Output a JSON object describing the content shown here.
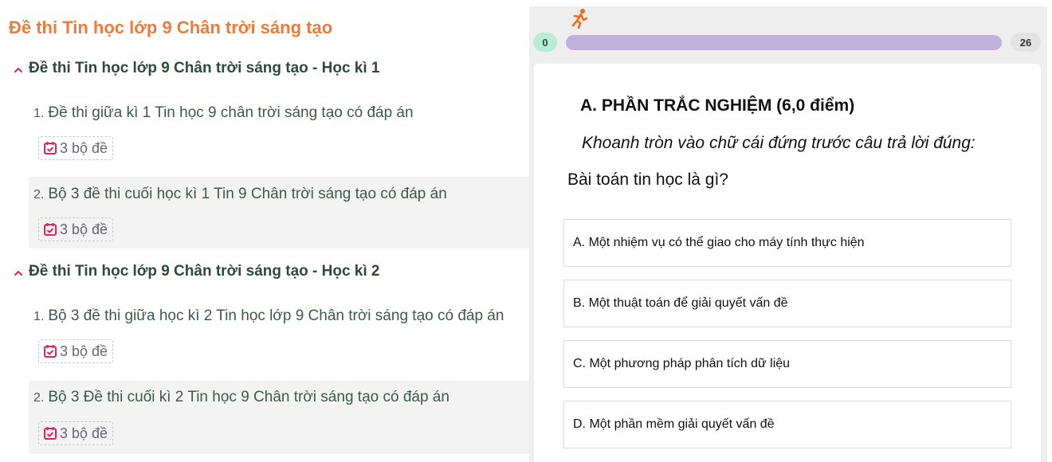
{
  "page_title": "Đề thi Tin học lớp 9 Chân trời sáng tạo",
  "sections": [
    {
      "heading": "Đề thi Tin học lớp 9 Chân trời sáng tạo - Học kì 1",
      "items": [
        {
          "number": "1.",
          "title": "Đề thi giữa kì 1 Tin học 9 chân trời sáng tạo có đáp án",
          "badge": "3 bộ đề"
        },
        {
          "number": "2.",
          "title": "Bộ 3 đề thi cuối học kì 1 Tin 9 Chân trời sáng tạo có đáp án",
          "badge": "3 bộ đề"
        }
      ]
    },
    {
      "heading": "Đề thi Tin học lớp 9 Chân trời sáng tạo - Học kì 2",
      "items": [
        {
          "number": "1.",
          "title": "Bộ 3 đề thi giữa học kì 2 Tin học lớp 9 Chân trời sáng tạo có đáp án",
          "badge": "3 bộ đề"
        },
        {
          "number": "2.",
          "title": "Bộ 3 Đề thi cuối kì 2 Tin học 9 Chân trời sáng tạo có đáp án",
          "badge": "3 bộ đề"
        }
      ]
    }
  ],
  "quiz": {
    "progress": {
      "current": "0",
      "total": "26",
      "fill_fraction": 1.0
    },
    "runner_icon": "running-person-icon",
    "section_title": "A. PHẦN TRẮC NGHIỆM (6,0 điểm)",
    "instruction": "Khoanh tròn vào chữ cái đứng trước câu trả lời đúng:",
    "question": "Bài toán tin học là gì?",
    "options": [
      "A. Một nhiệm vụ có thể giao cho máy tính thực hiện",
      "B. Một thuật toán để giải quyết vấn đề",
      "C. Một phương pháp phân tích dữ liệu",
      "D. Một phần mềm giải quyết vấn đề"
    ]
  },
  "colors": {
    "title_orange": "#ee7b3a",
    "heading_green": "#2f4a3c",
    "badge_icon_red": "#e0245e",
    "progress_fill": "#c0b1da",
    "counter_start_bg": "#b7ecd7"
  }
}
